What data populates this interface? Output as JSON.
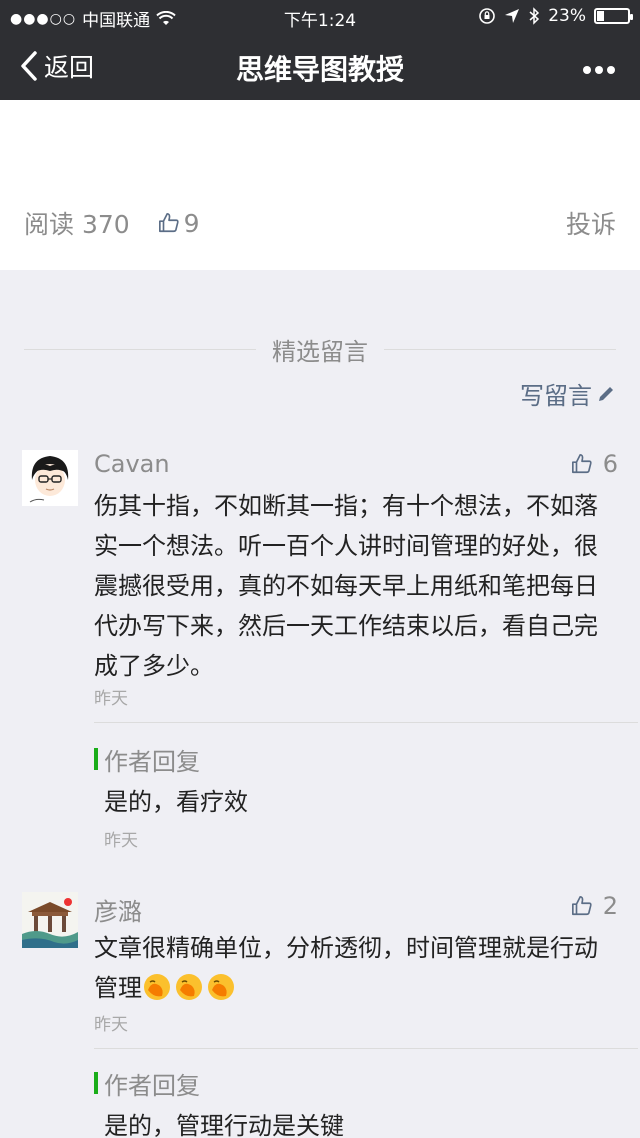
{
  "status_bar": {
    "carrier": "中国联通",
    "time": "下午1:24",
    "battery": "23%",
    "battery_level": 0.23
  },
  "nav": {
    "back_label": "返回",
    "title": "思维导图教授"
  },
  "article": {
    "read_label": "阅读 370",
    "like_count": "9",
    "report_label": "投诉"
  },
  "comments_section": {
    "title": "精选留言",
    "write_label": "写留言"
  },
  "comments": [
    {
      "name": "Cavan",
      "likes": "6",
      "text": "伤其十指，不如断其一指；有十个想法，不如落实一个想法。听一百个人讲时间管理的好处，很震撼很受用，真的不如每天早上用纸和笔把每日代办写下来，然后一天工作结束以后，看自己完成了多少。",
      "time": "昨天",
      "reply": {
        "label": "作者回复",
        "text": "是的，看疗效",
        "time": "昨天"
      }
    },
    {
      "name": "彦潞",
      "likes": "2",
      "text": "文章很精确单位，分析透彻，时间管理就是行动管理",
      "time": "昨天",
      "reply": {
        "label": "作者回复",
        "text": "是的，管理行动是关键",
        "time": ""
      }
    }
  ],
  "colors": {
    "nav_bg": "#2e2f33",
    "page_bg": "#efeff4",
    "link": "#5b6d86",
    "reply_bar": "#1aad19"
  }
}
